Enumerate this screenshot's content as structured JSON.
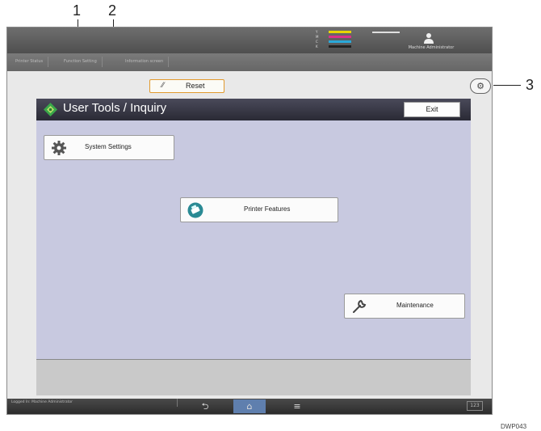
{
  "callouts": [
    "1",
    "2",
    "3"
  ],
  "topbar": {
    "toner": [
      {
        "letter": "Y",
        "color": "#e8d400"
      },
      {
        "letter": "M",
        "color": "#d8308a"
      },
      {
        "letter": "C",
        "color": "#2aa8d8"
      },
      {
        "letter": "K",
        "color": "#222222"
      }
    ],
    "user_label": "Machine Administrator"
  },
  "tabs": [
    "Printer Status",
    "Function Setting",
    "Information screen"
  ],
  "reset_label": "Reset",
  "user_tools": {
    "title": "User Tools / Inquiry",
    "exit_label": "Exit",
    "buttons": {
      "system_settings": "System Settings",
      "printer_features": "Printer Features",
      "maintenance": "Maintenance"
    }
  },
  "bottombar": {
    "login_text": "Logged In: Machine Administrator",
    "keyboard_label": "123"
  },
  "figure_code": "DWP043"
}
